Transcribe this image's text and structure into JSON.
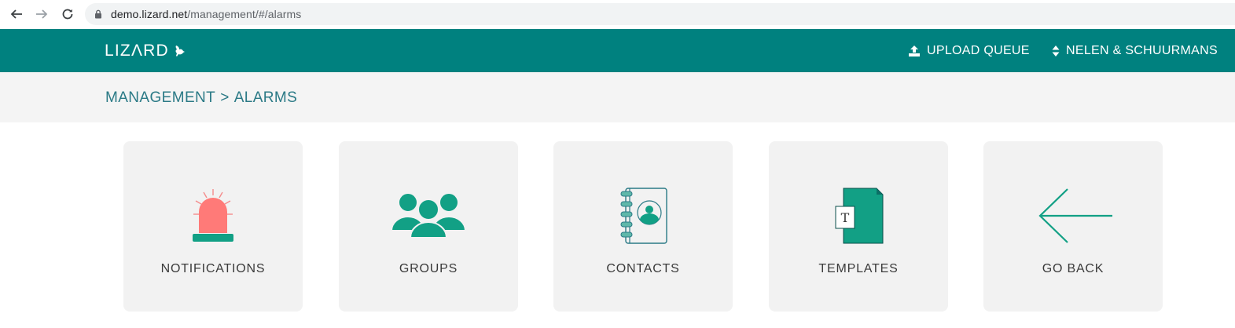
{
  "browser": {
    "url_host": "demo.lizard.net",
    "url_path": "/management/#/alarms"
  },
  "header": {
    "logo": "LIZΛRD",
    "upload_label": "UPLOAD QUEUE",
    "org_label": "NELEN & SCHUURMANS",
    "color": "#00817f"
  },
  "breadcrumb": {
    "parent": "MANAGEMENT",
    "separator": ">",
    "current": "ALARMS"
  },
  "tiles": [
    {
      "label": "NOTIFICATIONS",
      "icon": "siren-icon"
    },
    {
      "label": "GROUPS",
      "icon": "people-group-icon"
    },
    {
      "label": "CONTACTS",
      "icon": "address-book-icon"
    },
    {
      "label": "TEMPLATES",
      "icon": "template-document-icon"
    },
    {
      "label": "GO BACK",
      "icon": "arrow-left-icon"
    }
  ]
}
